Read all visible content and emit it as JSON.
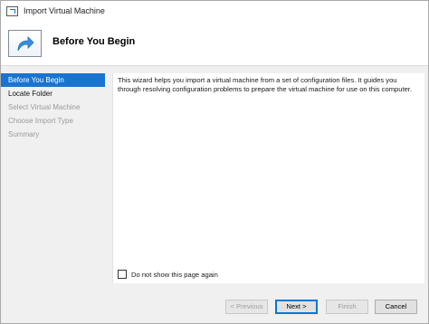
{
  "window": {
    "title": "Import Virtual Machine"
  },
  "header": {
    "title": "Before You Begin"
  },
  "nav": {
    "items": [
      {
        "label": "Before You Begin"
      },
      {
        "label": "Locate Folder"
      },
      {
        "label": "Select Virtual Machine"
      },
      {
        "label": "Choose Import Type"
      },
      {
        "label": "Summary"
      }
    ]
  },
  "content": {
    "description": "This wizard helps you import a virtual machine from a set of configuration files. It guides you through resolving configuration problems to prepare the virtual machine for use on this computer.",
    "checkbox_label": "Do not show this page again",
    "checkbox_checked": false
  },
  "footer": {
    "previous_label": "< Previous",
    "next_label": "Next >",
    "finish_label": "Finish",
    "cancel_label": "Cancel"
  },
  "colors": {
    "accent": "#1874d0"
  },
  "icons": {
    "app": "import-vm-icon",
    "header": "arrow-forward-icon"
  }
}
